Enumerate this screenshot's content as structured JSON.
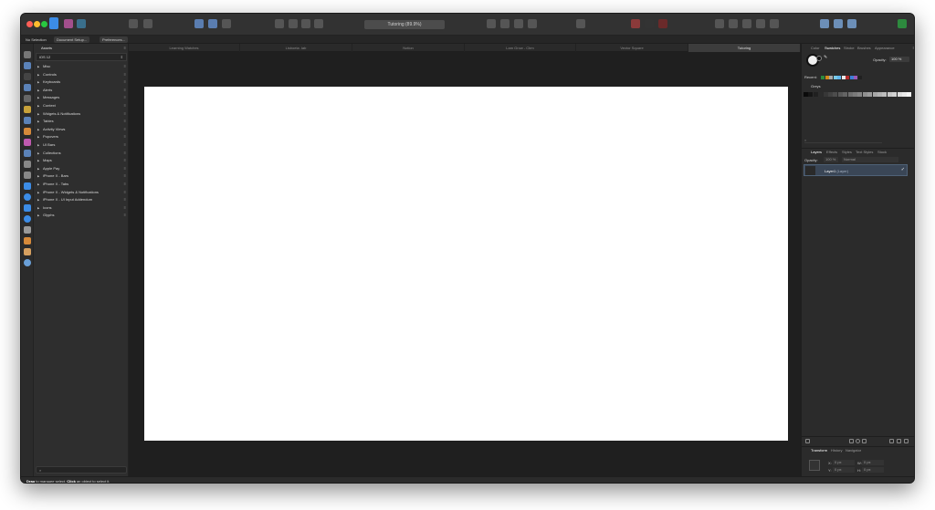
{
  "app": {
    "document_title": "Tutoring (89.9%)"
  },
  "context_toolbar": {
    "selection": "No Selection",
    "document_setup": "Document Setup...",
    "preferences": "Preferences..."
  },
  "doc_tabs": [
    "Learning Watches",
    "Lisboeta .lab",
    "Notion",
    "Lam Grow - Cbm",
    "Vector Square",
    "Tutoring"
  ],
  "assets_panel": {
    "tab": "Assets",
    "selected_category": "iOS 12",
    "items": [
      "Misc",
      "Controls",
      "Keyboards",
      "Alerts",
      "Messages",
      "Context",
      "Widgets & Notifications",
      "Tables",
      "Activity Views",
      "Popovers",
      "UI Bars",
      "Collections",
      "Maps",
      "Apple Pay",
      "iPhone X - Bars",
      "iPhone X - Tabs",
      "iPhone X - Widgets & Notifications",
      "iPhone X - UI Input Addendum",
      "Icons",
      "Glyphs"
    ]
  },
  "right_panel": {
    "tabs": [
      "Color",
      "Swatches",
      "Stroke",
      "Brushes",
      "Appearance"
    ],
    "active_tab": "Swatches",
    "opacity_label": "Opacity:",
    "opacity_value": "100 %",
    "recent_label": "Recent:",
    "recent_colors": [
      "#2d8a3e",
      "#d38a1b",
      "#a8a8a8",
      "#7ac9e6",
      "#5fb7f0",
      "#e8e8e8",
      "#b32a2a",
      "#3d7fd6",
      "#9b59b6",
      "#202020"
    ],
    "palette_name": "Greys"
  },
  "layers_panel": {
    "tabs": [
      "Layers",
      "Effects",
      "Styles",
      "Text Styles",
      "Stock"
    ],
    "active_tab": "Layers",
    "opacity_label": "Opacity:",
    "opacity_value": "100 %",
    "blend_mode": "Normal",
    "layer_name": "Layer1",
    "layer_type": "(Layer)"
  },
  "transform_panel": {
    "tabs": [
      "Transform",
      "History",
      "Navigator"
    ],
    "active_tab": "Transform",
    "fields": {
      "x": "0 px",
      "y": "0 px",
      "w": "0 px",
      "h": "0 px",
      "r": "0 °",
      "s": "0 °"
    }
  },
  "status_bar": {
    "action1": "Drag",
    "text1": " to marquee select. ",
    "action2": "Click",
    "text2": " an object to select it."
  }
}
